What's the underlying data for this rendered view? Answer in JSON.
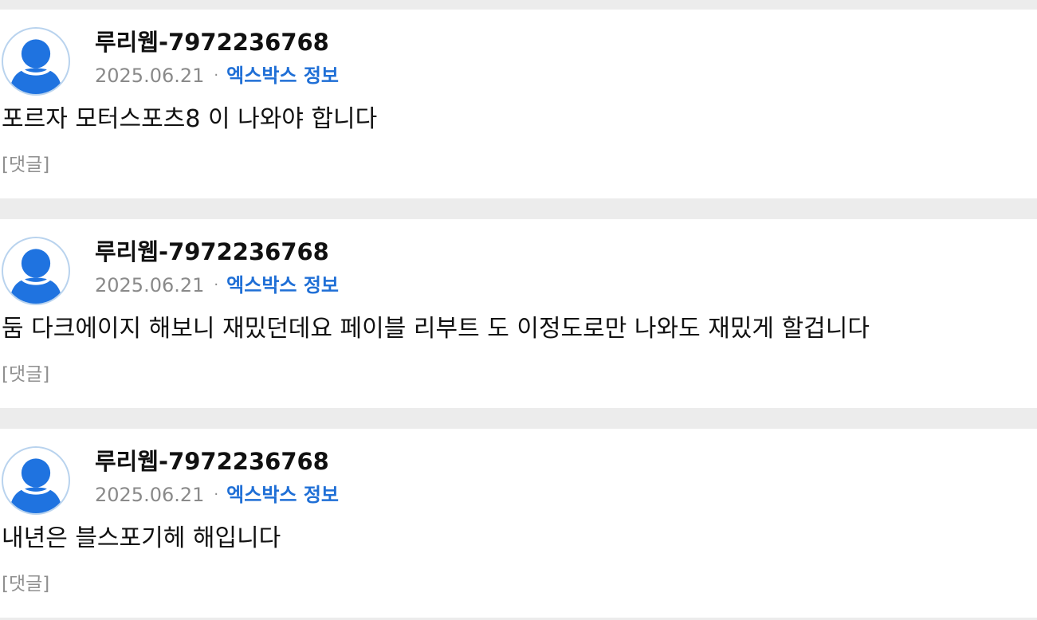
{
  "posts": [
    {
      "username": "루리웹-7972236768",
      "date": "2025.06.21",
      "separator": "·",
      "board": "엑스박스 정보",
      "content": "포르자 모터스포츠8 이 나와야 합니다",
      "comment_label": "[댓글]"
    },
    {
      "username": "루리웹-7972236768",
      "date": "2025.06.21",
      "separator": "·",
      "board": "엑스박스 정보",
      "content": "둠 다크에이지 해보니 재밌던데요 페이블 리부트 도 이정도로만 나와도 재밌게 할겁니다",
      "comment_label": "[댓글]"
    },
    {
      "username": "루리웹-7972236768",
      "date": "2025.06.21",
      "separator": "·",
      "board": "엑스박스 정보",
      "content": "내년은 블스포기헤 해입니다",
      "comment_label": "[댓글]"
    }
  ],
  "colors": {
    "avatar_fill": "#1f73e0",
    "board_link": "#1f6fd6",
    "muted": "#8a8a8a",
    "divider": "#ececec"
  },
  "icons": {
    "avatar": "user-silhouette-icon"
  }
}
